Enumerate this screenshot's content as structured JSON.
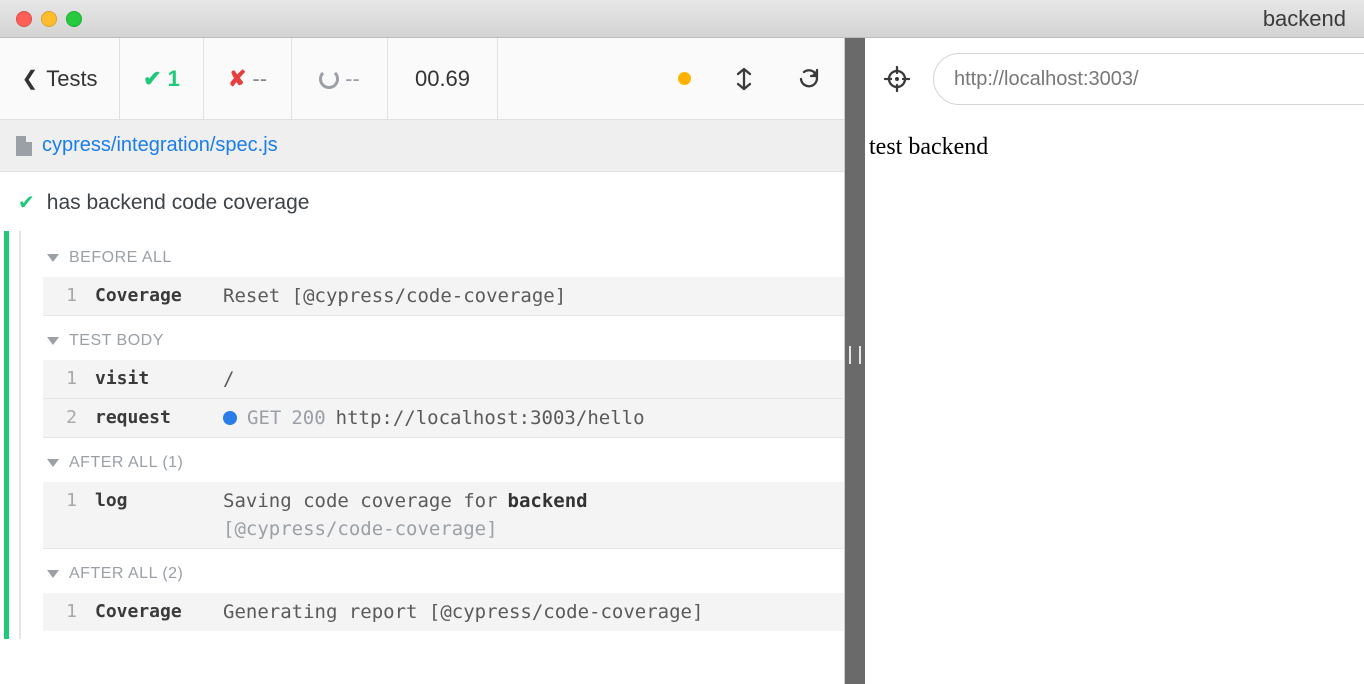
{
  "window": {
    "title": "backend"
  },
  "toolbar": {
    "back_label": "Tests",
    "passed": "1",
    "failed": "--",
    "pending": "--",
    "duration": "00.69"
  },
  "spec": {
    "path": "cypress/integration/spec.js"
  },
  "test": {
    "title": "has backend code coverage"
  },
  "sections": {
    "before": {
      "label": "BEFORE ALL"
    },
    "body": {
      "label": "TEST BODY"
    },
    "after1": {
      "label": "AFTER ALL (1)"
    },
    "after2": {
      "label": "AFTER ALL (2)"
    }
  },
  "cmds": {
    "before1": {
      "num": "1",
      "name": "Coverage",
      "msg": "Reset [@cypress/code-coverage]"
    },
    "body1": {
      "num": "1",
      "name": "visit",
      "msg": "/"
    },
    "body2": {
      "num": "2",
      "name": "request",
      "method": "GET",
      "status": "200",
      "url": "http://localhost:3003/hello"
    },
    "after1a": {
      "num": "1",
      "name": "log",
      "line1a": "Saving code coverage for ",
      "line1b": "backend",
      "line2": "[@cypress/code-coverage]"
    },
    "after2a": {
      "num": "1",
      "name": "Coverage",
      "msg": "Generating report [@cypress/code-coverage]"
    }
  },
  "preview": {
    "url": "http://localhost:3003/",
    "body": "test backend"
  }
}
